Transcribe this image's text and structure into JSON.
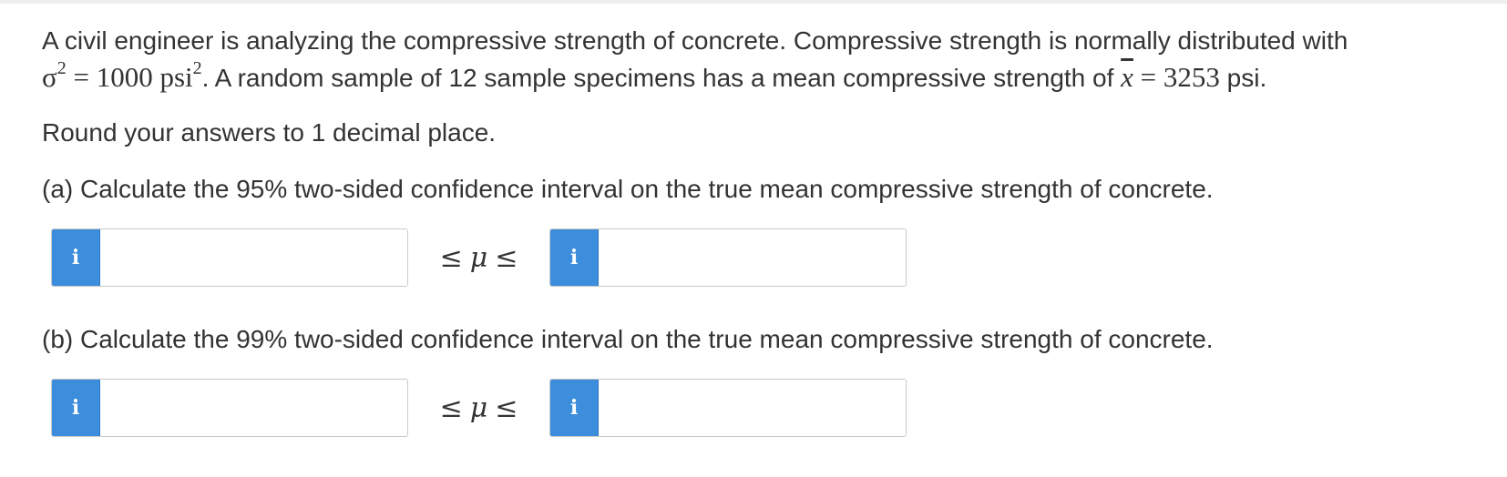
{
  "problem": {
    "line1": "A civil engineer is analyzing the compressive strength of concrete. Compressive strength is normally distributed with",
    "sigma_symbol": "σ",
    "sigma_exp": "2",
    "equals1": " = ",
    "variance_value": "1000 psi",
    "variance_exp": "2",
    "line2_text": ". A random sample of 12 sample specimens has a mean compressive strength of ",
    "xbar_symbol": "x",
    "equals2": " = ",
    "mean_value": "3253",
    "mean_unit": " psi."
  },
  "instruction": "Round your answers to 1 decimal place.",
  "part_a": {
    "question": "(a) Calculate the 95% two-sided confidence interval on the true mean compressive strength of concrete.",
    "lower_value": "",
    "upper_value": "",
    "info_label": "i",
    "leq_left": "≤",
    "mu": "μ",
    "leq_right": "≤"
  },
  "part_b": {
    "question": "(b) Calculate the 99% two-sided confidence interval on the true mean compressive strength of concrete.",
    "lower_value": "",
    "upper_value": "",
    "info_label": "i",
    "leq_left": "≤",
    "mu": "μ",
    "leq_right": "≤"
  },
  "colors": {
    "info_button": "#3c8ddb",
    "text": "#333333",
    "input_border": "#c9c9c9"
  },
  "icons": {
    "info": "info-icon"
  }
}
